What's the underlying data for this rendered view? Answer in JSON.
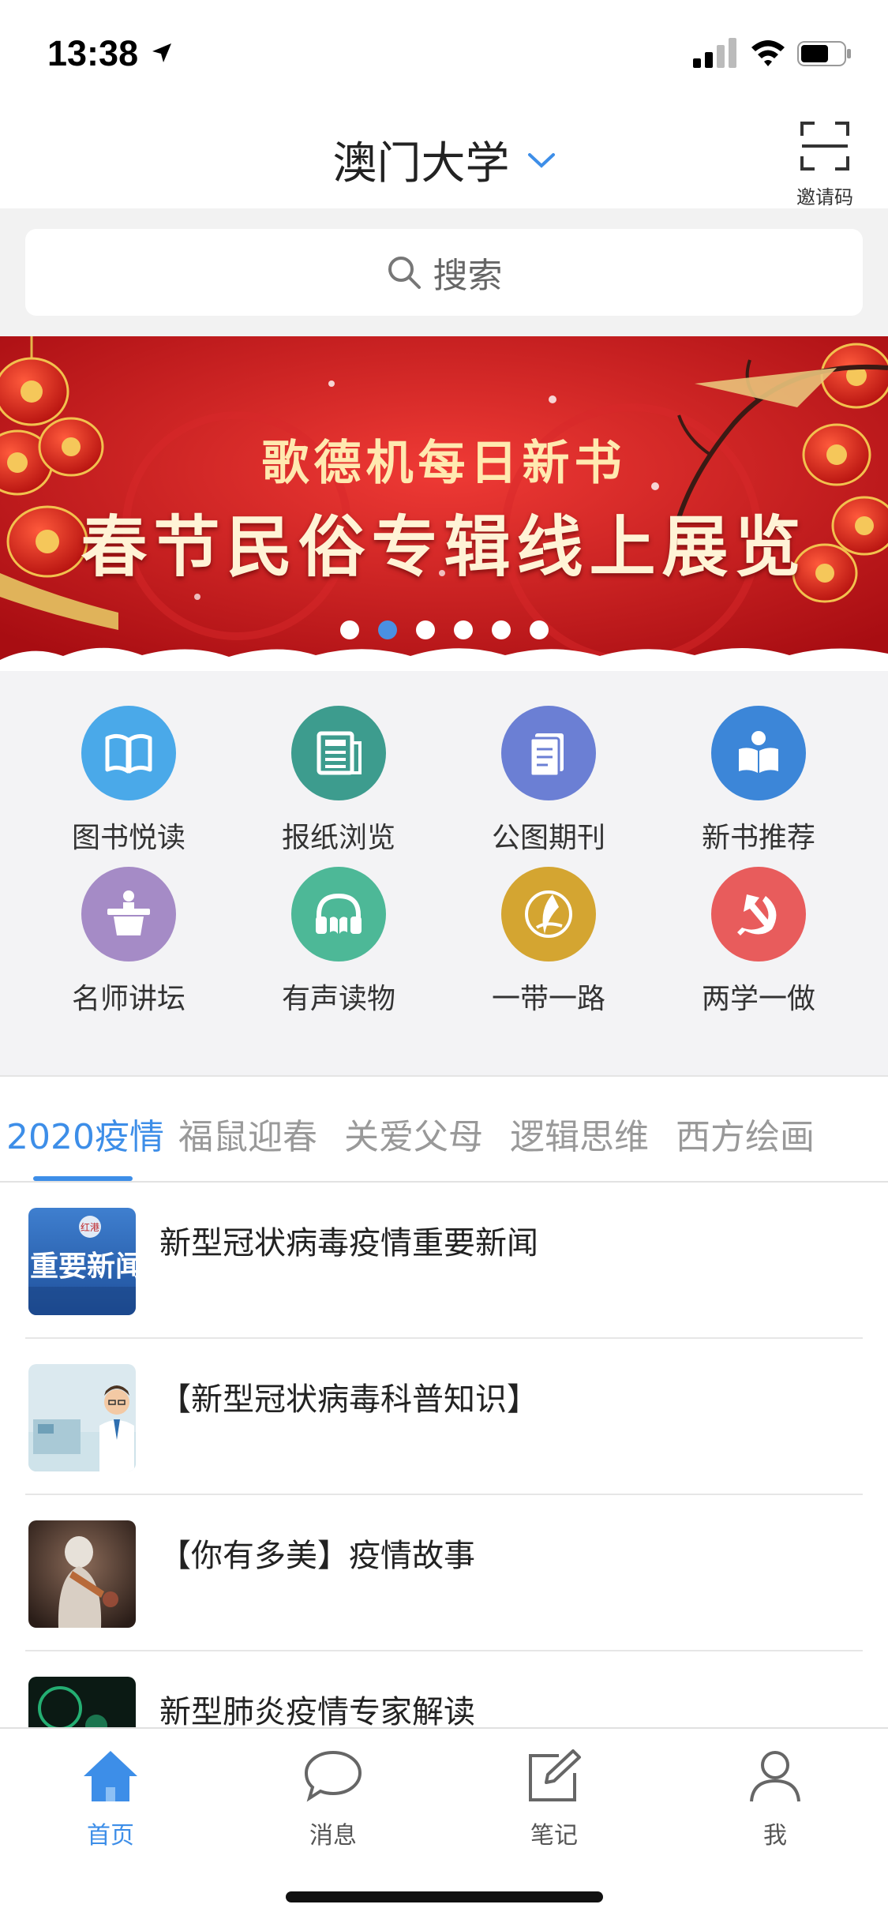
{
  "status_bar": {
    "time": "13:38"
  },
  "header": {
    "title": "澳门大学",
    "invite_label": "邀请码"
  },
  "search": {
    "placeholder": "搜索"
  },
  "banner": {
    "line1": "歌德机每日新书",
    "line2": "春节民俗专辑线上展览",
    "dot_count": 6,
    "active_dot": 2
  },
  "grid": {
    "items": [
      {
        "label": "图书悦读",
        "icon": "book-icon",
        "color": "#4aa9e9"
      },
      {
        "label": "报纸浏览",
        "icon": "newspaper-icon",
        "color": "#3d9c8e"
      },
      {
        "label": "公图期刊",
        "icon": "journal-icon",
        "color": "#6b7fd4"
      },
      {
        "label": "新书推荐",
        "icon": "reader-icon",
        "color": "#3c86d8"
      },
      {
        "label": "名师讲坛",
        "icon": "podium-icon",
        "color": "#a58bc6"
      },
      {
        "label": "有声读物",
        "icon": "headphones-icon",
        "color": "#4db897"
      },
      {
        "label": "一带一路",
        "icon": "belt-road-icon",
        "color": "#d4a531"
      },
      {
        "label": "两学一做",
        "icon": "hammer-sickle-icon",
        "color": "#e85c5c"
      }
    ]
  },
  "tabs": [
    {
      "label": "2020疫情",
      "active": true
    },
    {
      "label": "福鼠迎春",
      "active": false
    },
    {
      "label": "关爱父母",
      "active": false
    },
    {
      "label": "逻辑思维",
      "active": false
    },
    {
      "label": "西方绘画",
      "active": false
    }
  ],
  "news": [
    {
      "title": "新型冠状病毒疫情重要新闻",
      "thumb_text": "重要新闻",
      "thumb_badge": "红港"
    },
    {
      "title": "【新型冠状病毒科普知识】"
    },
    {
      "title": "【你有多美】疫情故事"
    },
    {
      "title": "新型肺炎疫情专家解读"
    }
  ],
  "tabbar": [
    {
      "label": "首页",
      "icon": "home-icon",
      "active": true
    },
    {
      "label": "消息",
      "icon": "message-icon",
      "active": false
    },
    {
      "label": "笔记",
      "icon": "note-icon",
      "active": false
    },
    {
      "label": "我",
      "icon": "user-icon",
      "active": false
    }
  ],
  "colors": {
    "accent": "#3d8ee8",
    "banner_red": "#c8161e"
  }
}
